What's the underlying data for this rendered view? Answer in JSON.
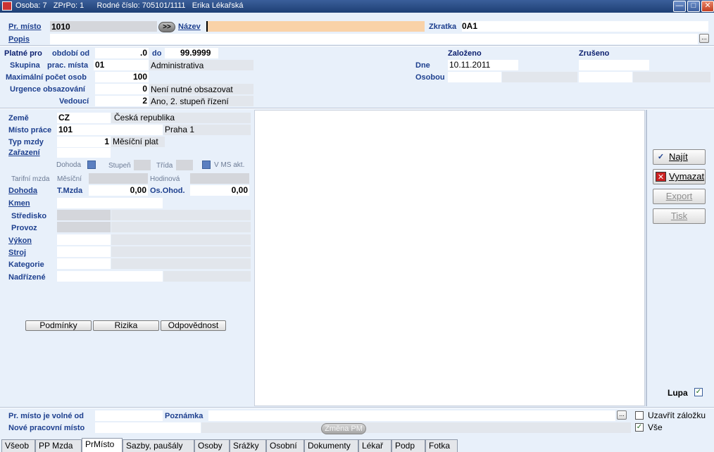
{
  "titlebar": {
    "text": "Osoba: 7   ZPrPo: 1      Rodné číslo: 705101/1111   Erika Lékařská"
  },
  "header": {
    "pr_misto_label": "Pr. místo",
    "pr_misto_value": "1010",
    "arrow_button": ">>",
    "nazev_label": "Název",
    "nazev_value": "",
    "zkratka_label": "Zkratka",
    "zkratka_value": "0A1",
    "popis_label": "Popis",
    "popis_value": "",
    "popis_button": "..."
  },
  "validity": {
    "platne_pro": "Platné pro",
    "obdobi_od": "období od",
    "od_value": ".0",
    "do_label": "do",
    "do_value": "99.9999",
    "skupina_label": "Skupina",
    "prac_mista": "prac. místa",
    "skupina_value": "01",
    "skupina_name": "Administrativa",
    "max_label": "Maximální počet osob",
    "max_value": "100",
    "urgence_label": "Urgence obsazování",
    "urgence_value": "0",
    "urgence_text": "Není nutné obsazovat",
    "vedouci_label": "Vedoucí",
    "vedouci_value": "2",
    "vedouci_text": "Ano, 2. stupeň řízení"
  },
  "audit": {
    "zalozeno": "Založeno",
    "zruseno": "Zrušeno",
    "dne_label": "Dne",
    "dne_value": "10.11.2011",
    "osobou_label": "Osobou"
  },
  "left": {
    "zeme_label": "Země",
    "zeme_value": "CZ",
    "zeme_name": "Česká republika",
    "misto_prace_label": "Místo práce",
    "misto_prace_value": "101",
    "misto_prace_name": "Praha 1",
    "typ_mzdy_label": "Typ mzdy",
    "typ_mzdy_value": "1",
    "typ_mzdy_name": "Měsíční plat",
    "zarazeni_label": "Zařazení",
    "dohoda_small": "Dohoda",
    "stupen_label": "Stupeň",
    "trida_label": "Třída",
    "vms_label": "V MS akt.",
    "tarifni_label": "Tarifní mzda",
    "mesicni_label": "Měsíční",
    "hodinova_label": "Hodinová",
    "dohoda_label": "Dohoda",
    "tmzda_label": "T.Mzda",
    "tmzda_value": "0,00",
    "oshod_label": "Os.Ohod.",
    "oshod_value": "0,00",
    "kmen_label": "Kmen",
    "stredisko_label": "Středisko",
    "provoz_label": "Provoz",
    "vykon_label": "Výkon",
    "stroj_label": "Stroj",
    "kategorie_label": "Kategorie",
    "nadrizene_label": "Nadřízené",
    "btn_podminky": "Podmínky",
    "btn_rizika": "Rizika",
    "btn_odpovednost": "Odpovědnost"
  },
  "right_buttons": {
    "najit": "Najít",
    "vymazat": "Vymazat",
    "export": "Export",
    "tisk": "Tisk",
    "lupa": "Lupa"
  },
  "bottom": {
    "volne_label": "Pr. místo je volné od",
    "poznamka_label": "Poznámka",
    "nove_label": "Nové pracovní místo",
    "zmena_button": "Změna PM",
    "uzavrit_label": "Uzavřít záložku",
    "vse_label": "Vše",
    "poznamka_button": "..."
  },
  "tabs": [
    "Všeob",
    "PP Mzda",
    "PrMísto",
    "Sazby, paušály",
    "Osoby",
    "Srážky",
    "Osobní",
    "Dokumenty",
    "Lékař",
    "Podp",
    "Fotka"
  ],
  "colors": {
    "accent": "#1d3f8e",
    "nazev_bg": "#f9d2a8",
    "titlebar": "#2a4b86"
  }
}
